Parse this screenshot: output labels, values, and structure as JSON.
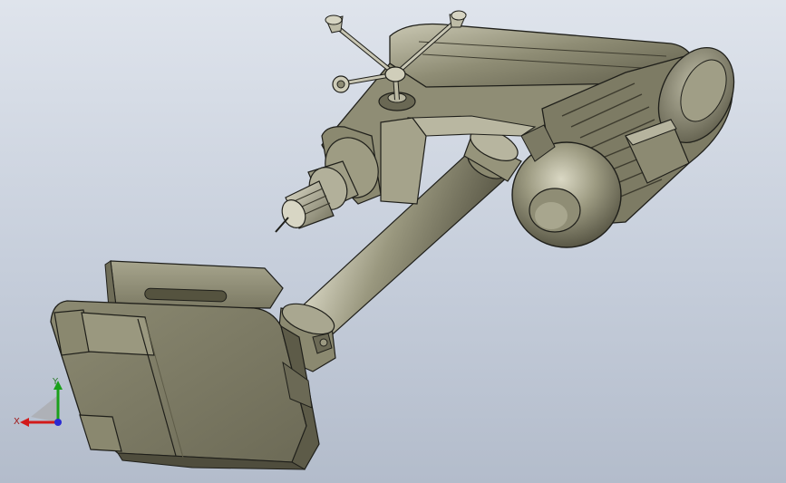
{
  "viewport": {
    "background_top": "#dfe4ec",
    "background_bottom": "#b3bccb",
    "model_color": "#8d8b72",
    "model_shadow": "#4e4c3c",
    "model_highlight": "#d2d0bd",
    "edge_color": "#1f1f1a"
  },
  "model": {
    "parts": [
      "drill-head",
      "motor",
      "handwheel",
      "chuck",
      "column",
      "base-table"
    ]
  },
  "triad": {
    "x_label": "X",
    "y_label": "Y",
    "x_color": "#d21a1a",
    "y_color": "#1aa01a",
    "z_color": "#2a2ad2",
    "x_icon": "arrow-left-icon",
    "y_icon": "arrow-up-icon"
  }
}
